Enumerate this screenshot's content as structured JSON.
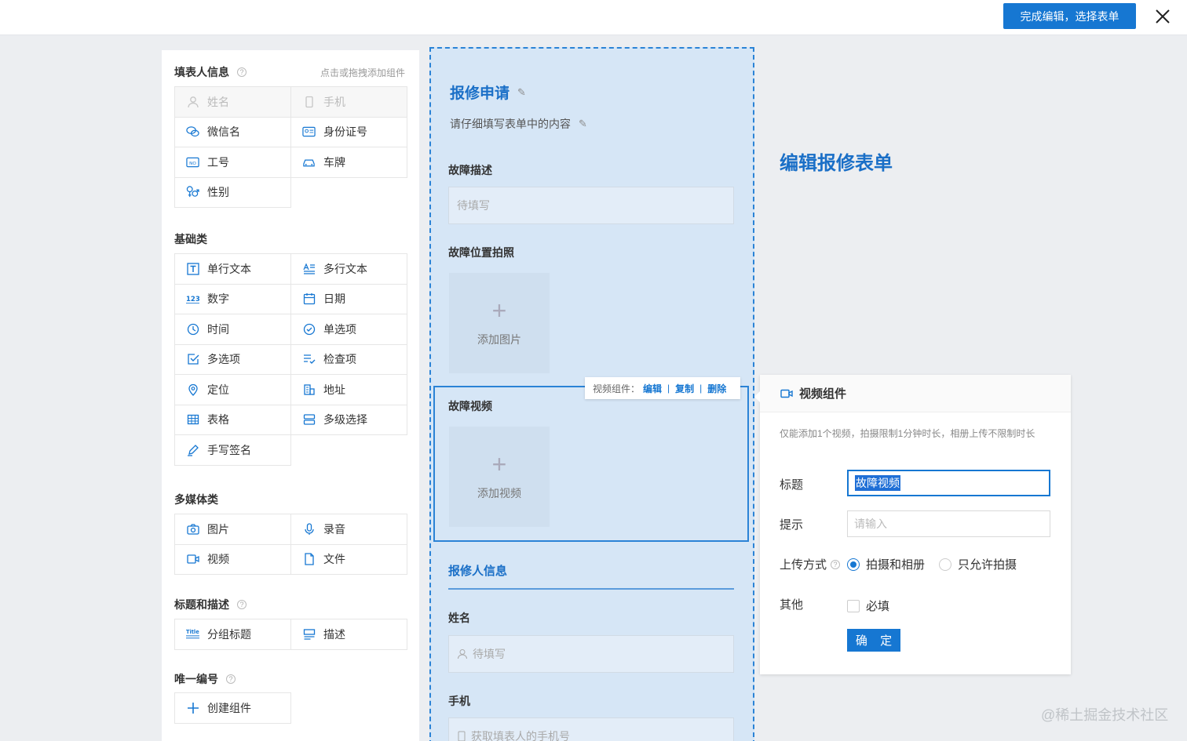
{
  "topbar": {
    "done_button": "完成编辑，选择表单"
  },
  "palette": {
    "hint": "点击或拖拽添加组件",
    "sections": [
      {
        "title": "填表人信息",
        "help": true,
        "items": [
          {
            "label": "姓名",
            "icon": "person-icon",
            "disabled": true
          },
          {
            "label": "手机",
            "icon": "phone-icon",
            "disabled": true
          },
          {
            "label": "微信名",
            "icon": "wechat-icon"
          },
          {
            "label": "身份证号",
            "icon": "id-card-icon"
          },
          {
            "label": "工号",
            "icon": "badge-icon"
          },
          {
            "label": "车牌",
            "icon": "car-icon"
          },
          {
            "label": "性别",
            "icon": "gender-icon"
          }
        ]
      },
      {
        "title": "基础类",
        "help": false,
        "items": [
          {
            "label": "单行文本",
            "icon": "text-t-icon"
          },
          {
            "label": "多行文本",
            "icon": "multiline-text-icon"
          },
          {
            "label": "数字",
            "icon": "number-icon"
          },
          {
            "label": "日期",
            "icon": "calendar-icon"
          },
          {
            "label": "时间",
            "icon": "clock-icon"
          },
          {
            "label": "单选项",
            "icon": "radio-check-icon"
          },
          {
            "label": "多选项",
            "icon": "checkbox-icon"
          },
          {
            "label": "检查项",
            "icon": "checklist-icon"
          },
          {
            "label": "定位",
            "icon": "location-pin-icon"
          },
          {
            "label": "地址",
            "icon": "building-icon"
          },
          {
            "label": "表格",
            "icon": "table-icon"
          },
          {
            "label": "多级选择",
            "icon": "cascade-icon"
          },
          {
            "label": "手写签名",
            "icon": "pen-sign-icon"
          }
        ]
      },
      {
        "title": "多媒体类",
        "help": false,
        "items": [
          {
            "label": "图片",
            "icon": "camera-icon"
          },
          {
            "label": "录音",
            "icon": "microphone-icon"
          },
          {
            "label": "视频",
            "icon": "video-icon"
          },
          {
            "label": "文件",
            "icon": "file-icon"
          }
        ]
      },
      {
        "title": "标题和描述",
        "help": true,
        "items": [
          {
            "label": "分组标题",
            "icon": "title-icon"
          },
          {
            "label": "描述",
            "icon": "description-icon"
          }
        ]
      },
      {
        "title": "唯一编号",
        "help": true,
        "items": [
          {
            "label": "创建组件",
            "icon": "plus-icon"
          }
        ]
      }
    ]
  },
  "form": {
    "title": "报修申请",
    "description": "请仔细填写表单中的内容",
    "fields": {
      "fault_desc": {
        "label": "故障描述",
        "placeholder": "待填写"
      },
      "fault_photo": {
        "label": "故障位置拍照",
        "button": "添加图片"
      },
      "fault_video": {
        "label": "故障视频",
        "button": "添加视频"
      },
      "group_title": "报修人信息",
      "name": {
        "label": "姓名",
        "placeholder": "待填写"
      },
      "phone": {
        "label": "手机",
        "placeholder": "获取填表人的手机号"
      }
    },
    "toolbar": {
      "prefix": "视频组件：",
      "edit": "编辑",
      "copy": "复制",
      "delete": "删除",
      "separator": "|"
    }
  },
  "heading": "编辑报修表单",
  "property_panel": {
    "title": "视频组件",
    "tip": "仅能添加1个视频，拍摄限制1分钟时长，相册上传不限制时长",
    "title_label": "标题",
    "title_value": "故障视频",
    "hint_label": "提示",
    "hint_placeholder": "请输入",
    "upload_label": "上传方式",
    "upload_options": [
      "拍摄和相册",
      "只允许拍摄"
    ],
    "upload_selected": 0,
    "other_label": "其他",
    "required_label": "必填",
    "required_checked": false,
    "confirm": "确 定"
  },
  "colors": {
    "accent": "#1677d2",
    "canvas_bg": "#d6e6f6"
  },
  "watermark": "@稀土掘金技术社区"
}
